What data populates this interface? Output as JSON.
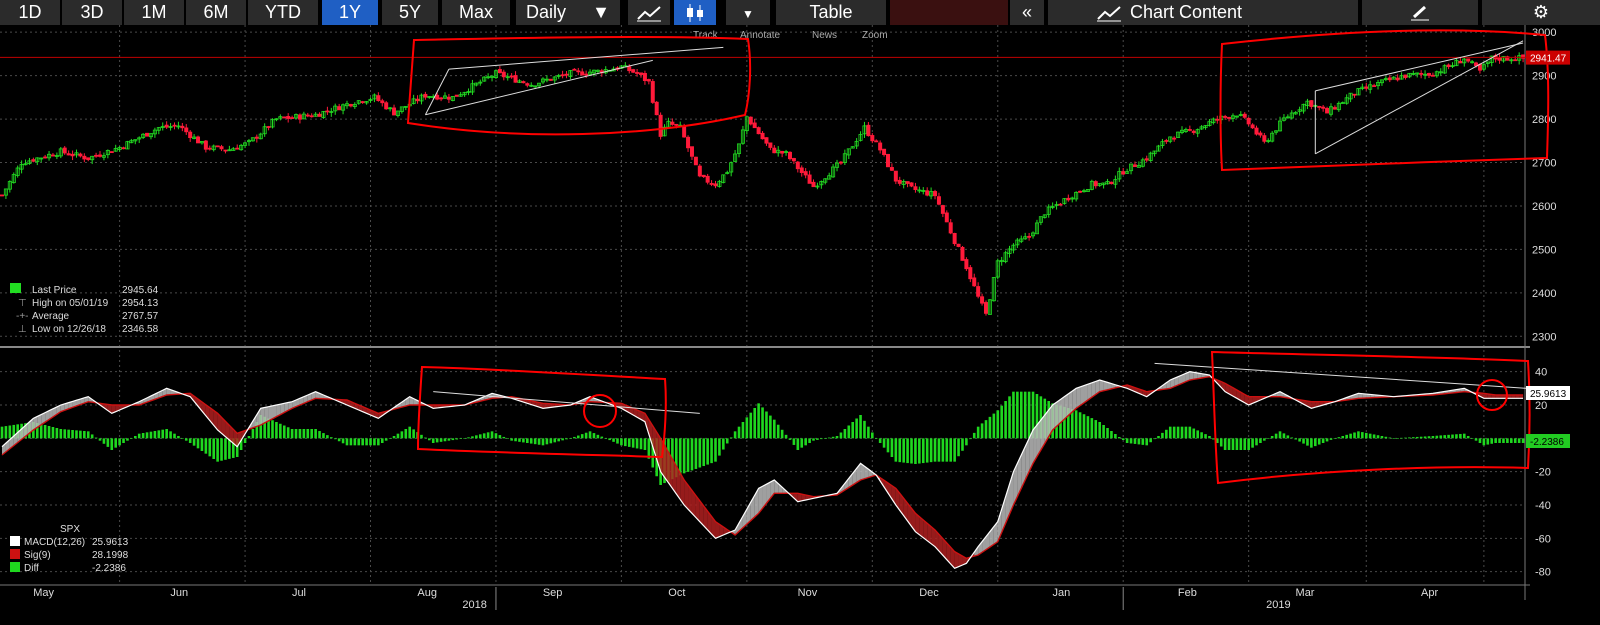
{
  "toolbar": {
    "periods": [
      "1D",
      "3D",
      "1M",
      "6M",
      "YTD",
      "1Y",
      "5Y",
      "Max"
    ],
    "active_period": "1Y",
    "frequency": "Daily",
    "table_label": "Table",
    "chart_content_label": "Chart Content"
  },
  "overlay_menu": [
    "Track",
    "Annotate",
    "News",
    "Zoom"
  ],
  "legend_price": {
    "rows": [
      {
        "label": "Last Price",
        "value": "2945.64"
      },
      {
        "label": "High on 05/01/19",
        "value": "2954.13"
      },
      {
        "label": "Average",
        "value": "2767.57"
      },
      {
        "label": "Low on 12/26/18",
        "value": "2346.58"
      }
    ]
  },
  "legend_macd": {
    "title": "SPX",
    "rows": [
      {
        "label": "MACD(12,26)",
        "value": "25.9613"
      },
      {
        "label": "Sig(9)",
        "value": "28.1998"
      },
      {
        "label": "Diff",
        "value": "-2.2386"
      }
    ]
  },
  "price_tag": "2941.47",
  "macd_tag": "25.9613",
  "diff_tag": "-2.2386",
  "colors": {
    "up": "#22dd22",
    "down": "#ff1a3a",
    "macd": "#ffffff",
    "signal": "#cc1111",
    "diff": "#1fd81f",
    "annotation": "#ff0000",
    "grid": "#555555"
  },
  "chart_data": [
    {
      "type": "candlestick",
      "y_ticks": [
        2300,
        2400,
        2500,
        2600,
        2700,
        2800,
        2900,
        3000
      ],
      "ylim": [
        2280,
        3005
      ],
      "x_tick_labels": [
        "May",
        "Jun",
        "Jul",
        "Aug",
        "Sep",
        "Oct",
        "Nov",
        "Dec",
        "Jan",
        "Feb",
        "Mar",
        "Apr"
      ],
      "year_labels": [
        "2018",
        "2019"
      ],
      "anchors": [
        [
          0,
          2625
        ],
        [
          5,
          2700
        ],
        [
          15,
          2725
        ],
        [
          22,
          2710
        ],
        [
          30,
          2735
        ],
        [
          40,
          2780
        ],
        [
          45,
          2785
        ],
        [
          52,
          2735
        ],
        [
          58,
          2730
        ],
        [
          63,
          2745
        ],
        [
          70,
          2800
        ],
        [
          80,
          2810
        ],
        [
          90,
          2840
        ],
        [
          95,
          2850
        ],
        [
          100,
          2815
        ],
        [
          108,
          2855
        ],
        [
          115,
          2850
        ],
        [
          122,
          2885
        ],
        [
          126,
          2905
        ],
        [
          135,
          2880
        ],
        [
          145,
          2905
        ],
        [
          152,
          2910
        ],
        [
          158,
          2920
        ],
        [
          162,
          2905
        ],
        [
          165,
          2885
        ],
        [
          168,
          2765
        ],
        [
          170,
          2790
        ],
        [
          173,
          2780
        ],
        [
          178,
          2665
        ],
        [
          182,
          2650
        ],
        [
          185,
          2680
        ],
        [
          188,
          2740
        ],
        [
          190,
          2805
        ],
        [
          196,
          2730
        ],
        [
          200,
          2720
        ],
        [
          207,
          2645
        ],
        [
          214,
          2700
        ],
        [
          220,
          2780
        ],
        [
          224,
          2730
        ],
        [
          228,
          2660
        ],
        [
          232,
          2640
        ],
        [
          238,
          2625
        ],
        [
          243,
          2520
        ],
        [
          246,
          2460
        ],
        [
          249,
          2390
        ],
        [
          251,
          2350
        ],
        [
          254,
          2470
        ],
        [
          258,
          2510
        ],
        [
          262,
          2530
        ],
        [
          266,
          2585
        ],
        [
          272,
          2620
        ],
        [
          278,
          2650
        ],
        [
          282,
          2650
        ],
        [
          286,
          2680
        ],
        [
          292,
          2710
        ],
        [
          298,
          2760
        ],
        [
          304,
          2775
        ],
        [
          310,
          2800
        ],
        [
          315,
          2812
        ],
        [
          318,
          2790
        ],
        [
          322,
          2745
        ],
        [
          327,
          2800
        ],
        [
          333,
          2840
        ],
        [
          338,
          2815
        ],
        [
          345,
          2860
        ],
        [
          352,
          2885
        ],
        [
          358,
          2900
        ],
        [
          365,
          2905
        ],
        [
          370,
          2925
        ],
        [
          373,
          2940
        ],
        [
          377,
          2910
        ],
        [
          380,
          2940
        ]
      ],
      "horizontal_line": 2942,
      "last_price": 2941.47,
      "triangles": [
        {
          "upper": [
            [
              114,
              2915
            ],
            [
              184,
              2965
            ]
          ],
          "lower": [
            [
              108,
              2810
            ],
            [
              166,
              2935
            ]
          ]
        },
        {
          "upper": [
            [
              335,
              2865
            ],
            [
              388,
              2975
            ]
          ],
          "lower": [
            [
              335,
              2720
            ],
            [
              388,
              2980
            ]
          ]
        }
      ]
    },
    {
      "type": "macd",
      "y_ticks": [
        -80,
        -60,
        -40,
        -20,
        0,
        20,
        40
      ],
      "ylim": [
        -85,
        50
      ],
      "series": [
        {
          "name": "MACD(12,26)",
          "anchors": [
            [
              0,
              -5
            ],
            [
              8,
              12
            ],
            [
              15,
              20
            ],
            [
              22,
              25
            ],
            [
              28,
              15
            ],
            [
              35,
              22
            ],
            [
              42,
              30
            ],
            [
              48,
              25
            ],
            [
              55,
              5
            ],
            [
              60,
              -5
            ],
            [
              66,
              18
            ],
            [
              74,
              22
            ],
            [
              80,
              28
            ],
            [
              88,
              20
            ],
            [
              96,
              12
            ],
            [
              104,
              25
            ],
            [
              110,
              18
            ],
            [
              118,
              20
            ],
            [
              125,
              27
            ],
            [
              130,
              24
            ],
            [
              138,
              18
            ],
            [
              145,
              20
            ],
            [
              150,
              25
            ],
            [
              158,
              18
            ],
            [
              164,
              10
            ],
            [
              168,
              -20
            ],
            [
              174,
              -40
            ],
            [
              182,
              -60
            ],
            [
              187,
              -55
            ],
            [
              193,
              -30
            ],
            [
              197,
              -25
            ],
            [
              203,
              -38
            ],
            [
              207,
              -36
            ],
            [
              213,
              -33
            ],
            [
              219,
              -15
            ],
            [
              223,
              -22
            ],
            [
              228,
              -40
            ],
            [
              233,
              -56
            ],
            [
              238,
              -65
            ],
            [
              243,
              -78
            ],
            [
              246,
              -75
            ],
            [
              249,
              -65
            ],
            [
              254,
              -50
            ],
            [
              258,
              -20
            ],
            [
              263,
              5
            ],
            [
              268,
              20
            ],
            [
              274,
              30
            ],
            [
              280,
              35
            ],
            [
              287,
              30
            ],
            [
              292,
              25
            ],
            [
              298,
              35
            ],
            [
              303,
              40
            ],
            [
              308,
              38
            ],
            [
              312,
              28
            ],
            [
              318,
              20
            ],
            [
              326,
              28
            ],
            [
              334,
              18
            ],
            [
              340,
              22
            ],
            [
              346,
              27
            ],
            [
              355,
              25
            ],
            [
              365,
              27
            ],
            [
              373,
              30
            ],
            [
              378,
              24
            ],
            [
              381,
              24
            ]
          ]
        },
        {
          "name": "Sig(9)",
          "anchors": [
            [
              0,
              -10
            ],
            [
              8,
              5
            ],
            [
              15,
              16
            ],
            [
              22,
              22
            ],
            [
              28,
              20
            ],
            [
              35,
              20
            ],
            [
              42,
              26
            ],
            [
              48,
              27
            ],
            [
              55,
              15
            ],
            [
              60,
              3
            ],
            [
              66,
              8
            ],
            [
              74,
              18
            ],
            [
              80,
              24
            ],
            [
              88,
              23
            ],
            [
              96,
              15
            ],
            [
              104,
              20
            ],
            [
              110,
              20
            ],
            [
              118,
              20
            ],
            [
              125,
              24
            ],
            [
              130,
              25
            ],
            [
              138,
              21
            ],
            [
              145,
              20
            ],
            [
              150,
              22
            ],
            [
              158,
              21
            ],
            [
              164,
              15
            ],
            [
              168,
              0
            ],
            [
              174,
              -25
            ],
            [
              182,
              -50
            ],
            [
              187,
              -58
            ],
            [
              193,
              -45
            ],
            [
              197,
              -33
            ],
            [
              203,
              -33
            ],
            [
              207,
              -35
            ],
            [
              213,
              -34
            ],
            [
              219,
              -25
            ],
            [
              223,
              -22
            ],
            [
              228,
              -30
            ],
            [
              233,
              -45
            ],
            [
              238,
              -55
            ],
            [
              243,
              -68
            ],
            [
              246,
              -72
            ],
            [
              249,
              -70
            ],
            [
              254,
              -62
            ],
            [
              258,
              -40
            ],
            [
              263,
              -15
            ],
            [
              268,
              5
            ],
            [
              274,
              18
            ],
            [
              280,
              28
            ],
            [
              287,
              32
            ],
            [
              292,
              28
            ],
            [
              298,
              30
            ],
            [
              303,
              35
            ],
            [
              308,
              37
            ],
            [
              312,
              33
            ],
            [
              318,
              25
            ],
            [
              326,
              25
            ],
            [
              334,
              22
            ],
            [
              340,
              22
            ],
            [
              346,
              24
            ],
            [
              355,
              25
            ],
            [
              365,
              26
            ],
            [
              373,
              28
            ],
            [
              378,
              27
            ],
            [
              381,
              26
            ]
          ]
        }
      ],
      "trend_lines": [
        [
          [
            110,
            28
          ],
          [
            178,
            15
          ]
        ],
        [
          [
            294,
            45
          ],
          [
            389,
            30
          ]
        ]
      ]
    }
  ]
}
